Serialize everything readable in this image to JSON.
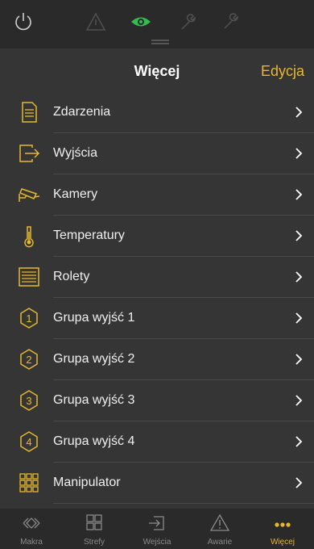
{
  "colors": {
    "accent": "#e6b82e",
    "active_status": "#2fbf4f",
    "background": "#353535",
    "bar": "#2a2a2a"
  },
  "status_icons": [
    "power-icon",
    "warning-icon",
    "eye-icon",
    "wrench-icon",
    "wrench-icon"
  ],
  "header": {
    "title": "Więcej",
    "edit_label": "Edycja"
  },
  "items": [
    {
      "label": "Zdarzenia",
      "icon": "document-icon"
    },
    {
      "label": "Wyjścia",
      "icon": "exit-icon"
    },
    {
      "label": "Kamery",
      "icon": "camera-icon"
    },
    {
      "label": "Temperatury",
      "icon": "thermometer-icon"
    },
    {
      "label": "Rolety",
      "icon": "blinds-icon"
    },
    {
      "label": "Grupa wyjść 1",
      "icon": "hexagon-1-icon",
      "number": "1"
    },
    {
      "label": "Grupa wyjść 2",
      "icon": "hexagon-2-icon",
      "number": "2"
    },
    {
      "label": "Grupa wyjść 3",
      "icon": "hexagon-3-icon",
      "number": "3"
    },
    {
      "label": "Grupa wyjść 4",
      "icon": "hexagon-4-icon",
      "number": "4"
    },
    {
      "label": "Manipulator",
      "icon": "keypad-icon"
    }
  ],
  "tabs": [
    {
      "label": "Makra",
      "icon": "macro-icon"
    },
    {
      "label": "Strefy",
      "icon": "zones-icon"
    },
    {
      "label": "Wejścia",
      "icon": "input-icon"
    },
    {
      "label": "Awarie",
      "icon": "warning-icon"
    },
    {
      "label": "Więcej",
      "icon": "more-icon",
      "active": true
    }
  ]
}
